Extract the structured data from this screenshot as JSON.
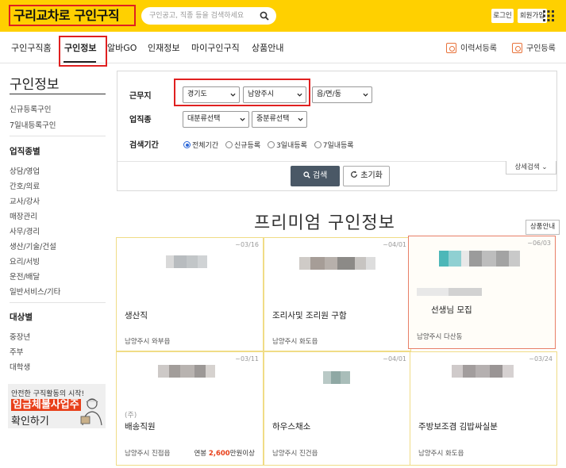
{
  "header": {
    "logo_prefix": "구리",
    "logo_strong": "교차로",
    "logo_suffix": "구인구직",
    "search_placeholder": "구인공고, 직종 등을 검색하세요",
    "login": "로그인",
    "signup": "회원가입"
  },
  "nav": {
    "items": [
      "구인구직홈",
      "구인정보",
      "알바GO",
      "인재정보",
      "마이구인구직",
      "상품안내"
    ],
    "resume_register": "이력서등록",
    "job_register": "구인등록"
  },
  "sidebar": {
    "title": "구인정보",
    "links": [
      "신규등록구인",
      "7일내등록구인"
    ],
    "job_heading": "업직종별",
    "jobs": [
      "상담/영업",
      "간호/의료",
      "교사/강사",
      "매장관리",
      "사무/경리",
      "생산/기술/건설",
      "요리/서빙",
      "운전/배달",
      "일반서비스/기타"
    ],
    "target_heading": "대상별",
    "targets": [
      "중장년",
      "주부",
      "대학생"
    ],
    "banner": {
      "line1": "안전한 구직활동의 시작!",
      "line2": "임금체불사업주",
      "line3": "확인하기"
    }
  },
  "filter": {
    "location_label": "근무지",
    "province": "경기도",
    "city": "남양주시",
    "town": "읍/면/동",
    "job_label": "업직종",
    "job_main": "대분류선택",
    "job_sub": "중분류선택",
    "period_label": "검색기간",
    "periods": [
      "전체기간",
      "신규등록",
      "3일내등록",
      "7일내등록"
    ],
    "detail": "상세검색",
    "search": "검색",
    "reset": "초기화"
  },
  "premium": {
    "title": "프리미엄 구인정보",
    "product_guide": "상품안내",
    "cards": [
      {
        "date": "~03/16",
        "company": "",
        "title": "생산직",
        "location": "남양주시 와부읍",
        "salary_prefix": "",
        "salary_amount": "",
        "salary_suffix": ""
      },
      {
        "date": "~04/01",
        "company": "",
        "title": "조리사및 조리원 구함",
        "location": "남양주시 화도읍",
        "salary_prefix": "",
        "salary_amount": "",
        "salary_suffix": ""
      },
      {
        "date": "~06/03",
        "company": "",
        "title": "선생님 모집",
        "location": "남양주시 다산동",
        "salary_prefix": "",
        "salary_amount": "",
        "salary_suffix": ""
      },
      {
        "date": "~03/11",
        "company": "(주)",
        "title": "배송직원",
        "location": "남양주시 진접읍",
        "salary_prefix": "연봉",
        "salary_amount": "2,600",
        "salary_suffix": "만원이상"
      },
      {
        "date": "~04/01",
        "company": "",
        "title": "하우스채소",
        "location": "남양주시 진건읍",
        "salary_prefix": "",
        "salary_amount": "",
        "salary_suffix": ""
      },
      {
        "date": "~03/24",
        "company": "",
        "title": "주방보조겸 김밥싸실분",
        "location": "남양주시 화도읍",
        "salary_prefix": "",
        "salary_amount": "",
        "salary_suffix": ""
      }
    ]
  },
  "colors": {
    "brand_yellow": "#ffd000",
    "highlight_red": "#e02020",
    "accent_orange": "#e8401a"
  }
}
